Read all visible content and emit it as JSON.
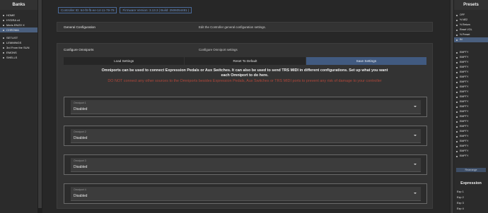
{
  "banks": {
    "title": "Banks",
    "items": [
      {
        "label": "HOME",
        "active": false
      },
      {
        "label": "HYDRA v4",
        "active": false
      },
      {
        "label": "Meris ENZO X",
        "active": false
      },
      {
        "label": "CHROMA",
        "active": true
      },
      {
        "label": "SETLIST",
        "active": false
      },
      {
        "label": "LEMMINGS",
        "active": false
      },
      {
        "label": "3rd From the SUN",
        "active": false
      },
      {
        "label": "EMONS",
        "active": false
      },
      {
        "label": "SHELLS",
        "active": false
      }
    ]
  },
  "header": {
    "controller_id": "Controller ID: 64-f8-fb-ee-14-11-79-79",
    "firmware": "Firmware Version: 3.13.3 | Build: 2506054481 |"
  },
  "general": {
    "title": "General Configuration",
    "description": "Edit the Controller general configuration settings."
  },
  "omniports": {
    "title": "Configure Omniports",
    "description": "Configure Omniport settings",
    "buttons": {
      "load": "Load Settings",
      "reset": "Reset To Default",
      "save": "Save Settings"
    },
    "info": "Omniports can be used to connect Expression Pedals or Aux Switches. It can also be used to send TRS MIDI in different configurations. Set up what you want each Omniport to do here.",
    "warning": "DO NOT connect any other sources to the Omniports besides Expression Pedals, Aux Switches or TRS MIDI ports to prevent any risk of damage to your controller",
    "ports": [
      {
        "label": "Omniport 1",
        "value": "Disabled"
      },
      {
        "label": "Omniport 2",
        "value": "Disabled"
      },
      {
        "label": "Omniport 3",
        "value": "Disabled"
      },
      {
        "label": "Omniport 4",
        "value": "Disabled"
      }
    ]
  },
  "presets": {
    "title": "Presets",
    "items_top": [
      {
        "label": "OFF",
        "active": false
      },
      {
        "label": "½ NE2",
        "active": false
      },
      {
        "label": "½ Return",
        "active": false
      },
      {
        "label": "Reset VOL",
        "active": false
      },
      {
        "label": "½ Preset",
        "active": false
      },
      {
        "label": "IN",
        "active": true
      }
    ],
    "items_empty": [
      "EMPTY",
      "EMPTY",
      "EMPTY",
      "EMPTY",
      "EMPTY",
      "EMPTY",
      "EMPTY",
      "EMPTY",
      "EMPTY",
      "EMPTY",
      "EMPTY",
      "EMPTY",
      "EMPTY",
      "EMPTY",
      "EMPTY",
      "EMPTY",
      "EMPTY",
      "EMPTY",
      "EMPTY",
      "EMPTY",
      "EMPTY",
      "EMPTY"
    ],
    "rearrange": "Rearrange"
  },
  "expression": {
    "title": "Expression",
    "items": [
      "Exp 1",
      "Exp 2",
      "Exp 3",
      "Exp 4"
    ]
  }
}
